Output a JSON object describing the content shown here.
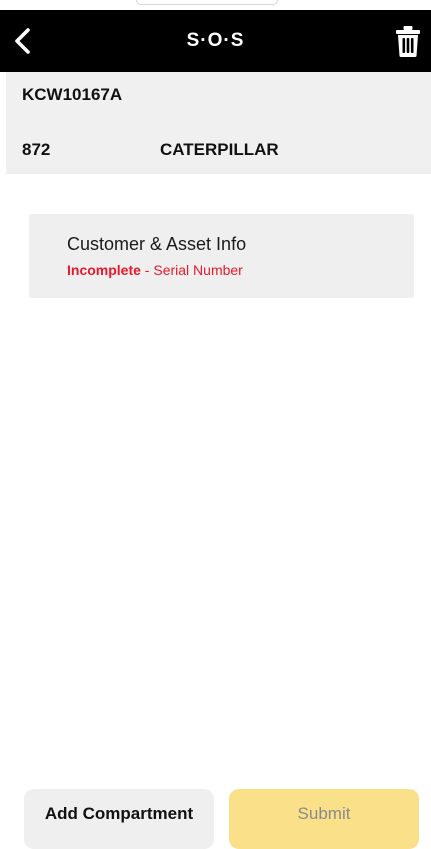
{
  "app": {
    "title": "S·O·S"
  },
  "asset": {
    "id": "KCW10167A",
    "model": "872",
    "make": "CATERPILLAR"
  },
  "sections": [
    {
      "title": "Customer & Asset Info",
      "status": "Incomplete",
      "separator": " - ",
      "detail": "Serial Number",
      "status_color": "#e8192c"
    }
  ],
  "footer": {
    "add_label": "Add Compartment",
    "submit_label": "Submit"
  },
  "icons": {
    "back": "chevron-left-icon",
    "delete": "trash-icon"
  },
  "colors": {
    "navbar": "#000000",
    "panel": "#f0f0f0",
    "submit": "#fbe08a",
    "alert": "#e8192c"
  }
}
